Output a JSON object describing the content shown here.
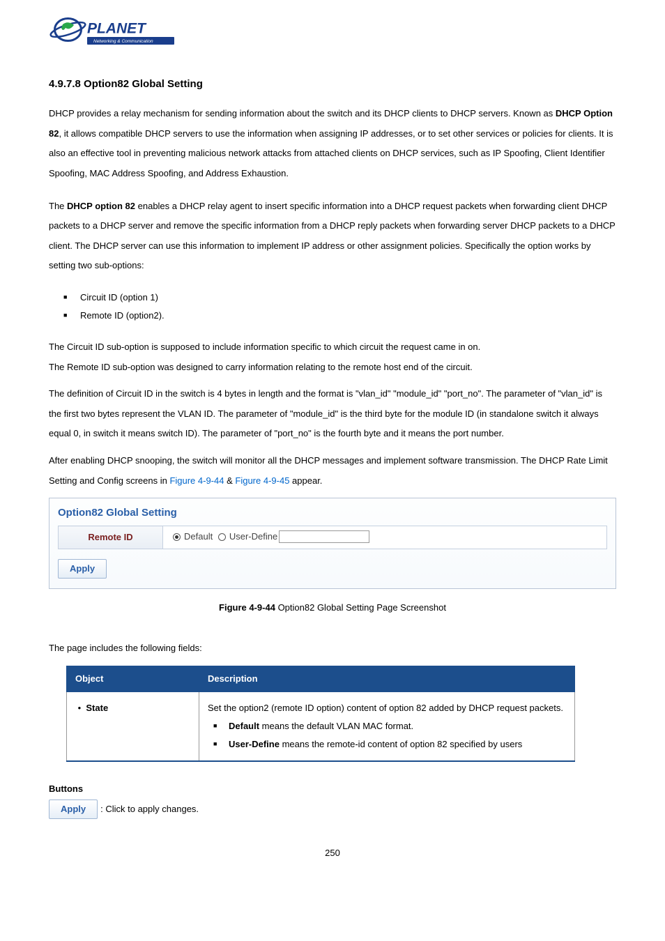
{
  "logo": {
    "brand": "PLANET",
    "tagline": "Networking & Communication"
  },
  "section_number": "4.9.7.8",
  "section_title": "Option82 Global Setting",
  "intro_parts": {
    "p1a": "DHCP provides a relay mechanism for sending information about the switch and its DHCP clients to DHCP servers. Known as ",
    "p1b": "DHCP Option 82",
    "p1c": ", it allows compatible DHCP servers to use the information when assigning IP addresses, or to set other services or policies for clients. It is also an effective tool in preventing malicious network attacks from attached clients on DHCP services, such as IP Spoofing, Client Identifier Spoofing, MAC Address Spoofing, and Address Exhaustion."
  },
  "para2_parts": {
    "a": "The ",
    "b": "DHCP option 82",
    "c": " enables a DHCP relay agent to insert specific information into a DHCP request packets when forwarding client DHCP packets to a DHCP server and remove the specific information from a DHCP reply packets when forwarding server DHCP packets to a DHCP client. The DHCP server can use this information to implement IP address or other assignment policies. Specifically the option works by setting two sub-options:"
  },
  "opt_list": [
    "Circuit ID (option 1)",
    "Remote ID (option2)."
  ],
  "para3": "The Circuit ID sub-option is supposed to include information specific to which circuit the request came in on.",
  "para4": "The Remote ID sub-option was designed to carry information relating to the remote host end of the circuit.",
  "para5": "The definition of Circuit ID in the switch is 4 bytes in length and the format is \"vlan_id\" \"module_id\" \"port_no\". The parameter of \"vlan_id\" is the first two bytes represent the VLAN ID. The parameter of \"module_id\" is the third byte for the module ID (in standalone switch it always equal 0, in switch it means switch ID). The parameter of \"port_no\" is the fourth byte and it means the port number.",
  "para6_parts": {
    "a": "After enabling DHCP snooping, the switch will monitor all the DHCP messages and implement software transmission. The DHCP Rate Limit Setting and Config screens in ",
    "link1": "Figure 4-9-44",
    "amp": " & ",
    "link2": "Figure 4-9-45",
    "tail": " appear."
  },
  "panel": {
    "title": "Option82 Global Setting",
    "row_label": "Remote ID",
    "radio_default": "Default",
    "radio_userdef": "User-Define",
    "apply": "Apply"
  },
  "figure_caption": {
    "num": "Figure 4-9-44",
    "text": " Option82 Global Setting Page Screenshot"
  },
  "fields_intro": "The page includes the following fields:",
  "desc_table": {
    "h1": "Object",
    "h2": "Description",
    "obj1": "State",
    "desc1_line1": "Set the option2 (remote ID option) content of option 82 added by DHCP request packets.",
    "desc1_b1": "Default",
    "desc1_b1t": " means the default VLAN MAC format.",
    "desc1_b2": "User-Define",
    "desc1_b2t": " means the remote-id content of option 82 specified by users"
  },
  "buttons_hdr": "Buttons",
  "apply_btn_text": "Apply",
  "apply_desc": ": Click to apply changes.",
  "page_num": "250"
}
